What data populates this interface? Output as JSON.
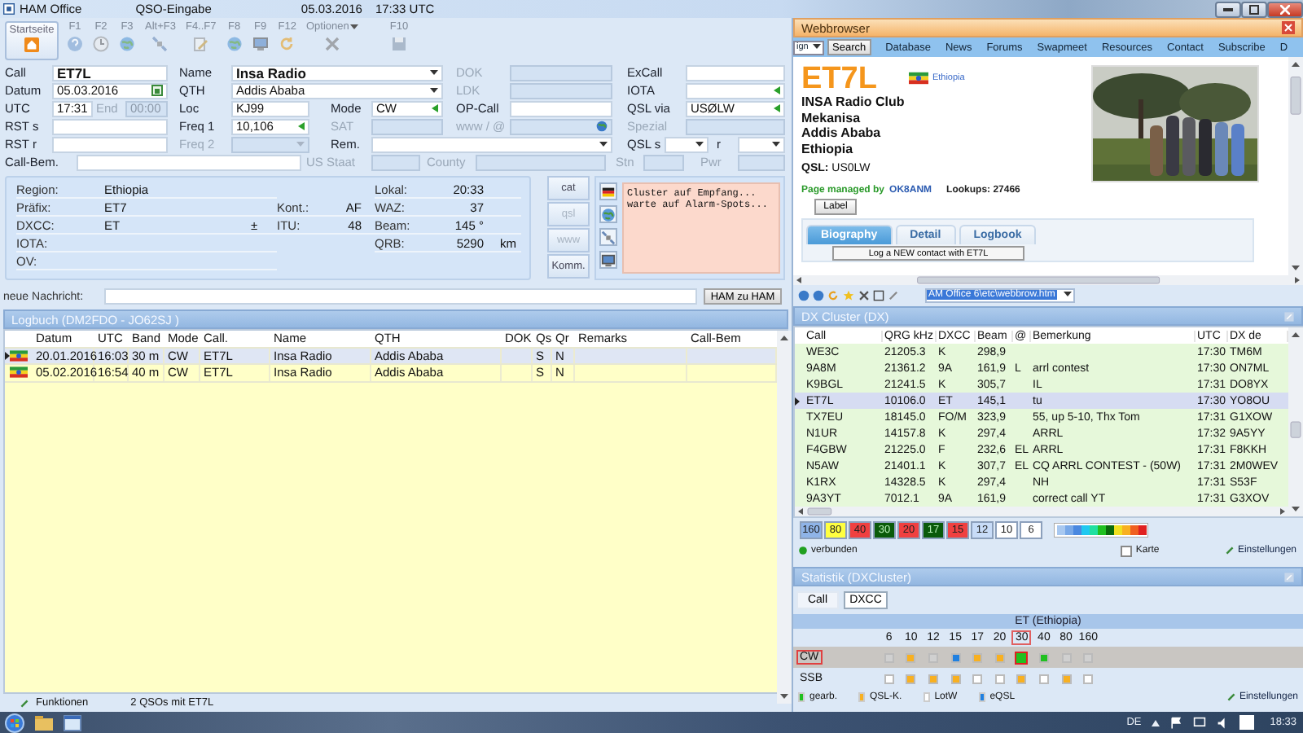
{
  "title_bar": {
    "app": "HAM Office",
    "screen": "QSO-Eingabe",
    "date": "05.03.2016",
    "time": "17:33 UTC"
  },
  "toolbar": {
    "home": "Startseite",
    "keys": [
      {
        "label": "F1",
        "kind": "help",
        "menu": false
      },
      {
        "label": "F2",
        "kind": "clock",
        "menu": false
      },
      {
        "label": "F3",
        "kind": "globe",
        "menu": false
      },
      {
        "label": "Alt+F3",
        "kind": "satellite",
        "menu": false
      },
      {
        "label": "F4..F7",
        "kind": "edit",
        "menu": false
      },
      {
        "label": "F8",
        "kind": "globe",
        "menu": false
      },
      {
        "label": "F9",
        "kind": "monitor",
        "menu": false
      },
      {
        "label": "F12",
        "kind": "refresh",
        "menu": false
      },
      {
        "label": "Optionen",
        "kind": "tools",
        "menu": true
      },
      {
        "label": "F10",
        "kind": "save",
        "menu": false
      }
    ]
  },
  "form": {
    "rows": [
      {
        "fields": [
          {
            "label": "Call",
            "value": "ET7L",
            "bold": true,
            "kind": "text",
            "disabled": false
          },
          {
            "label": "Name",
            "value": "Insa Radio",
            "bold": true,
            "kind": "dropdown",
            "disabled": false
          },
          {
            "label": "DOK",
            "kind": "text",
            "disabled": true
          },
          {
            "label": "ExCall",
            "kind": "text",
            "disabled": false
          }
        ]
      },
      {
        "fields": [
          {
            "label": "Datum",
            "value": "05.03.2016",
            "kind": "calendar",
            "disabled": false
          },
          {
            "label": "QTH",
            "value": "Addis  Ababa",
            "kind": "dropdown",
            "disabled": false
          },
          {
            "label": "LDK",
            "kind": "text",
            "disabled": true
          },
          {
            "label": "IOTA",
            "kind": "arrow",
            "disabled": false
          }
        ]
      },
      {
        "fields": [
          {
            "label": "UTC",
            "value": "17:31",
            "kind": "text",
            "disabled": false
          },
          {
            "label": "End",
            "value": "00:00",
            "kind": "text",
            "disabled": true
          },
          {
            "label": "Loc",
            "value": "KJ99",
            "kind": "text",
            "disabled": false
          },
          {
            "label": "Mode",
            "value": "CW",
            "kind": "arrow",
            "disabled": false
          },
          {
            "label": "OP-Call",
            "kind": "text",
            "disabled": false
          },
          {
            "label": "QSL via",
            "value": "USØLW",
            "kind": "arrow",
            "disabled": false
          }
        ]
      },
      {
        "fields": [
          {
            "label": "RST s",
            "kind": "text",
            "disabled": false
          },
          {
            "label": "Freq 1",
            "value": "10,106",
            "kind": "arrow",
            "disabled": false
          },
          {
            "label": "SAT",
            "kind": "text",
            "disabled": true
          },
          {
            "label": "www / @",
            "kind": "globe",
            "disabled": true
          },
          {
            "label": "Spezial",
            "kind": "text",
            "disabled": true
          }
        ]
      },
      {
        "fields": [
          {
            "label": "RST r",
            "kind": "text",
            "disabled": false
          },
          {
            "label": "Freq 2",
            "kind": "arrow",
            "disabled": true
          },
          {
            "label": "Rem.",
            "kind": "dropdown",
            "disabled": false
          },
          {
            "label": "QSL s",
            "kind": "dropdown",
            "disabled": false
          },
          {
            "label": "r",
            "kind": "dropdown",
            "disabled": false
          }
        ]
      },
      {
        "fields": [
          {
            "label": "Call-Bem.",
            "kind": "text",
            "disabled": false
          },
          {
            "label": "US Staat",
            "kind": "text",
            "disabled": true
          },
          {
            "label": "County",
            "kind": "text",
            "disabled": true
          },
          {
            "label": "Stn",
            "kind": "text",
            "disabled": true
          },
          {
            "label": "Pwr",
            "kind": "text",
            "disabled": true
          }
        ]
      }
    ]
  },
  "info": {
    "left": [
      {
        "label": "Region:",
        "value": "Ethiopia"
      },
      {
        "label": "Präfix:",
        "value": "ET7"
      },
      {
        "label": "DXCC:",
        "value": "ET",
        "suffix": "±"
      },
      {
        "label": "IOTA:"
      },
      {
        "label": "OV:"
      }
    ],
    "middle": [
      {
        "label": "Kont.:",
        "value": "AF"
      },
      {
        "label": "ITU:",
        "value": "48"
      }
    ],
    "right": [
      {
        "label": "Lokal:",
        "value": "20:33"
      },
      {
        "label": "WAZ:",
        "value": "37"
      },
      {
        "label": "Beam:",
        "value": "145 °"
      },
      {
        "label": "QRB:",
        "value": "5290",
        "unit": "km"
      }
    ],
    "buttons": [
      {
        "label": "cat",
        "disabled": false
      },
      {
        "label": "qsl",
        "disabled": true
      },
      {
        "label": "www",
        "disabled": true
      },
      {
        "label": "Komm.",
        "disabled": false
      }
    ],
    "tools": [
      {
        "kind": "flag"
      },
      {
        "kind": "globe"
      },
      {
        "kind": "satellite"
      },
      {
        "kind": "monitor"
      }
    ],
    "cluster_log": [
      "Cluster auf Empfang...",
      "warte auf Alarm-Spots..."
    ]
  },
  "message": {
    "label": "neue Nachricht:",
    "button": "HAM zu HAM"
  },
  "logbook": {
    "title": "Logbuch  (DM2FDO - JO62SJ )",
    "columns": [
      "Datum",
      "UTC",
      "Band",
      "Mode",
      "Call.",
      "Name",
      "QTH",
      "DOK",
      "Qs",
      "Qr",
      "Remarks",
      "Call-Bem"
    ],
    "rows": [
      {
        "selected": true,
        "date": "20.01.2016",
        "utc": "16:03",
        "band": "30 m",
        "mode": "CW",
        "call": "ET7L",
        "name": "Insa Radio",
        "qth": "Addis  Ababa",
        "qs": "S",
        "qr": "N"
      },
      {
        "selected": false,
        "date": "05.02.2016",
        "utc": "16:54",
        "band": "40 m",
        "mode": "CW",
        "call": "ET7L",
        "name": "Insa Radio",
        "qth": "Addis  Ababa",
        "qs": "S",
        "qr": "N"
      }
    ]
  },
  "status_bar": {
    "functions": "Funktionen",
    "summary": "2 QSOs mit ET7L"
  },
  "webbrowser": {
    "title": "Webbrowser",
    "nav": {
      "select": "ign",
      "search": "Search",
      "links": [
        "Database",
        "News",
        "Forums",
        "Swapmeet",
        "Resources",
        "Contact",
        "Subscribe",
        "D"
      ]
    },
    "page": {
      "call": "ET7L",
      "country": "Ethiopia",
      "address": [
        "INSA Radio Club",
        "Mekanisa",
        "Addis Ababa",
        "Ethiopia"
      ],
      "qsl": "**QSL:** US0LW",
      "managed": "Page managed by",
      "manager": "OK8ANM",
      "lookups": "Lookups: 27466",
      "label_button": "Label",
      "tabs": [
        {
          "label": "Biography",
          "selected": true
        },
        {
          "label": "Detail",
          "selected": false
        },
        {
          "label": "Logbook",
          "selected": false
        }
      ],
      "log_button": "Log a NEW contact with ET7L"
    },
    "address": "AM Office 6\\etc\\webbrow.htm"
  },
  "dx_cluster": {
    "title": "DX Cluster (DX)",
    "columns": [
      "Call",
      "QRG kHz",
      "DXCC",
      "Beam",
      "@",
      "Bemerkung",
      "UTC",
      "DX de"
    ],
    "rows": [
      {
        "selected": false,
        "call": "WE3C",
        "qrg": "21205.3",
        "dxcc": "K",
        "beam": "298,9",
        "utc": "17:30",
        "spotter": "TM6M"
      },
      {
        "selected": false,
        "call": "9A8M",
        "qrg": "21361.2",
        "dxcc": "9A",
        "beam": "161,9",
        "at": "L",
        "remark": "arrl contest",
        "utc": "17:30",
        "spotter": "ON7ML"
      },
      {
        "selected": false,
        "call": "K9BGL",
        "qrg": "21241.5",
        "dxcc": "K",
        "beam": "305,7",
        "remark": "IL",
        "utc": "17:31",
        "spotter": "DO8YX"
      },
      {
        "selected": true,
        "call": "ET7L",
        "qrg": "10106.0",
        "dxcc": "ET",
        "beam": "145,1",
        "remark": "tu",
        "utc": "17:30",
        "spotter": "YO8OU"
      },
      {
        "selected": false,
        "call": "TX7EU",
        "qrg": "18145.0",
        "dxcc": "FO/M",
        "beam": "323,9",
        "remark": "55, up 5-10, Thx Tom",
        "utc": "17:31",
        "spotter": "G1XOW"
      },
      {
        "selected": false,
        "call": "N1UR",
        "qrg": "14157.8",
        "dxcc": "K",
        "beam": "297,4",
        "remark": "ARRL",
        "utc": "17:32",
        "spotter": "9A5YY"
      },
      {
        "selected": false,
        "call": "F4GBW",
        "qrg": "21225.0",
        "dxcc": "F",
        "beam": "232,6",
        "at": "EL",
        "remark": "ARRL",
        "utc": "17:31",
        "spotter": "F8KKH"
      },
      {
        "selected": false,
        "call": "N5AW",
        "qrg": "21401.1",
        "dxcc": "K",
        "beam": "307,7",
        "at": "EL",
        "remark": "CQ ARRL CONTEST - (50W)",
        "utc": "17:31",
        "spotter": "2M0WEV"
      },
      {
        "selected": false,
        "call": "K1RX",
        "qrg": "14328.5",
        "dxcc": "K",
        "beam": "297,4",
        "remark": "NH",
        "utc": "17:31",
        "spotter": "S53F"
      },
      {
        "selected": false,
        "call": "9A3YT",
        "qrg": "7012.1",
        "dxcc": "9A",
        "beam": "161,9",
        "remark": "correct call YT",
        "utc": "17:31",
        "spotter": "G3XOV"
      }
    ],
    "bands": [
      {
        "label": "160",
        "color": "#8fb4e8"
      },
      {
        "label": "80",
        "color": "#ffff40"
      },
      {
        "label": "40",
        "color": "#f04040"
      },
      {
        "label": "30",
        "color": "#0a5a0a"
      },
      {
        "label": "20",
        "color": "#f04040"
      },
      {
        "label": "17",
        "color": "#0a5a0a"
      },
      {
        "label": "15",
        "color": "#f04040"
      },
      {
        "label": "12",
        "color": "#c8dcf8"
      },
      {
        "label": "10",
        "color": "#ffffff"
      },
      {
        "label": "6",
        "color": "#ffffff"
      }
    ],
    "connection": "verbunden",
    "map": {
      "label": "Karte",
      "checked": false
    },
    "settings": "Einstellungen"
  },
  "statistics": {
    "title": "Statistik (DXCluster)",
    "tabs": [
      {
        "label": "Call",
        "selected": false
      },
      {
        "label": "DXCC",
        "selected": true
      }
    ],
    "entity": "ET (Ethiopia)",
    "bands": [
      {
        "label": "6",
        "selected": false
      },
      {
        "label": "10",
        "selected": false
      },
      {
        "label": "12",
        "selected": false
      },
      {
        "label": "15",
        "selected": false
      },
      {
        "label": "17",
        "selected": false
      },
      {
        "label": "20",
        "selected": false
      },
      {
        "label": "30",
        "selected": true
      },
      {
        "label": "40",
        "selected": false
      },
      {
        "label": "80",
        "selected": false
      },
      {
        "label": "160",
        "selected": false
      }
    ],
    "modes": [
      {
        "label": "CW",
        "selected": true,
        "cells": [
          {
            "color": "#d0d0d0"
          },
          {
            "color": "#f8b020"
          },
          {
            "color": "#d0d0d0"
          },
          {
            "color": "#2080e0"
          },
          {
            "color": "#f8b020"
          },
          {
            "color": "#f8b020"
          },
          {
            "color": "#20c020"
          },
          {
            "color": "#20c020"
          },
          {
            "color": "#d0d0d0"
          },
          {
            "color": "#d0d0d0"
          }
        ]
      },
      {
        "label": "SSB",
        "selected": false,
        "cells": [
          {
            "color": "#ffffff"
          },
          {
            "color": "#f8b020"
          },
          {
            "color": "#f8b020"
          },
          {
            "color": "#f8b020"
          },
          {
            "color": "#ffffff"
          },
          {
            "color": "#ffffff"
          },
          {
            "color": "#f8b020"
          },
          {
            "color": "#ffffff"
          },
          {
            "color": "#f8b020"
          },
          {
            "color": "#ffffff"
          }
        ]
      }
    ],
    "legend": [
      {
        "label": "gearb.",
        "color": "#20c020"
      },
      {
        "label": "QSL-K.",
        "color": "#f8b020"
      },
      {
        "label": "LotW",
        "color": "#ffffff"
      },
      {
        "label": "eQSL",
        "color": "#2080e0"
      }
    ],
    "settings": "Einstellungen"
  },
  "taskbar": {
    "language": "DE",
    "time": "18:33"
  }
}
